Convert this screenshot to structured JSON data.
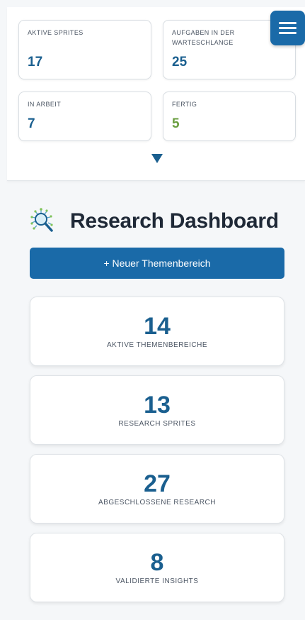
{
  "stats": [
    {
      "label": "AKTIVE SPRITES",
      "value": "17",
      "color": "#1a5f8f"
    },
    {
      "label": "AUFGABEN IN DER WARTESCHLANGE",
      "value": "25",
      "color": "#1a5f8f"
    },
    {
      "label": "IN ARBEIT",
      "value": "7",
      "color": "#1a5f8f"
    },
    {
      "label": "FERTIG",
      "value": "5",
      "color": "#6a9e3f"
    }
  ],
  "dashboard": {
    "title": "Research Dashboard",
    "icon": "research-magnifier-icon",
    "new_button_label": "+ Neuer Themenbereich"
  },
  "metrics": [
    {
      "value": "14",
      "label": "AKTIVE THEMENBEREICHE"
    },
    {
      "value": "13",
      "label": "RESEARCH SPRITES"
    },
    {
      "value": "27",
      "label": "ABGESCHLOSSENE RESEARCH"
    },
    {
      "value": "8",
      "label": "VALIDIERTE INSIGHTS"
    }
  ],
  "colors": {
    "accent": "#1a6aa8",
    "value_blue": "#1a5f8f",
    "done_green": "#6a9e3f"
  }
}
